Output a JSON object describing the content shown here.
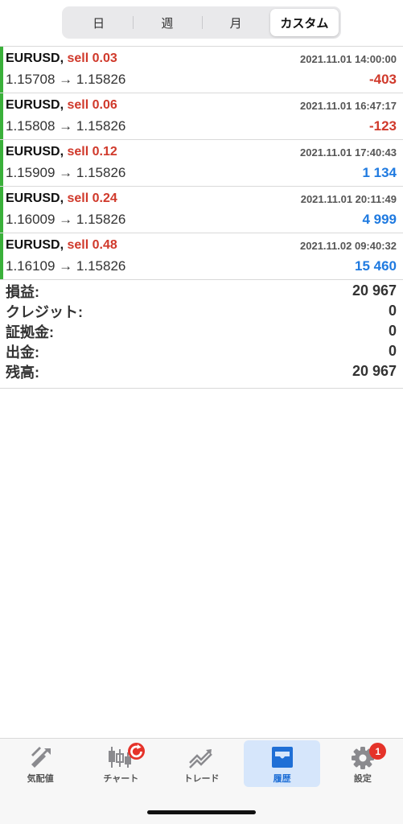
{
  "segments": [
    {
      "label": "日",
      "active": false
    },
    {
      "label": "週",
      "active": false
    },
    {
      "label": "月",
      "active": false
    },
    {
      "label": "カスタム",
      "active": true
    }
  ],
  "deals": [
    {
      "symbol": "EURUSD,",
      "action": "sell 0.03",
      "time": "2021.11.01 14:00:00",
      "prices": "1.15708 → 1.15826",
      "profit": "-403",
      "profit_sign": "neg"
    },
    {
      "symbol": "EURUSD,",
      "action": "sell 0.06",
      "time": "2021.11.01 16:47:17",
      "prices": "1.15808 → 1.15826",
      "profit": "-123",
      "profit_sign": "neg"
    },
    {
      "symbol": "EURUSD,",
      "action": "sell 0.12",
      "time": "2021.11.01 17:40:43",
      "prices": "1.15909 → 1.15826",
      "profit": "1 134",
      "profit_sign": "pos"
    },
    {
      "symbol": "EURUSD,",
      "action": "sell 0.24",
      "time": "2021.11.01 20:11:49",
      "prices": "1.16009 → 1.15826",
      "profit": "4 999",
      "profit_sign": "pos"
    },
    {
      "symbol": "EURUSD,",
      "action": "sell 0.48",
      "time": "2021.11.02 09:40:32",
      "prices": "1.16109 → 1.15826",
      "profit": "15 460",
      "profit_sign": "pos"
    }
  ],
  "summary": [
    {
      "label": "損益:",
      "value": "20 967"
    },
    {
      "label": "クレジット:",
      "value": "0"
    },
    {
      "label": "証拠金:",
      "value": "0"
    },
    {
      "label": "出金:",
      "value": "0"
    },
    {
      "label": "残高:",
      "value": "20 967"
    }
  ],
  "tabbar": {
    "items": [
      {
        "label": "気配値",
        "icon": "quotes-icon",
        "active": false
      },
      {
        "label": "チャート",
        "icon": "candlestick-chart-icon",
        "active": false,
        "badge": "refresh-icon"
      },
      {
        "label": "トレード",
        "icon": "trade-icon",
        "active": false
      },
      {
        "label": "履歴",
        "icon": "history-inbox-icon",
        "active": true
      },
      {
        "label": "設定",
        "icon": "gear-icon",
        "active": false,
        "badge": "1"
      }
    ]
  },
  "colors": {
    "sell": "#d0392b",
    "negative": "#d0392b",
    "positive": "#1f7ae0",
    "deal_bar": "#3ab03a",
    "tab_active_bg": "#d6e6fb",
    "badge": "#e5332a"
  }
}
